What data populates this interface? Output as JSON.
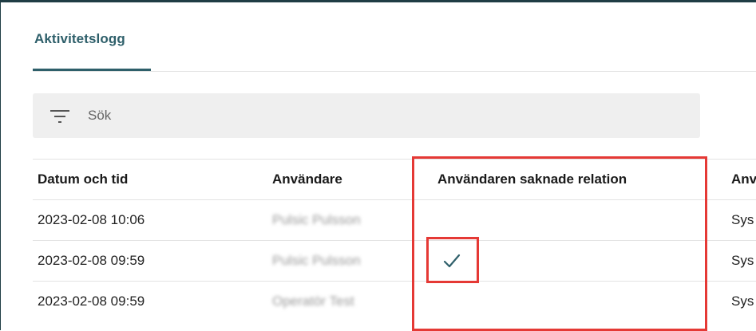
{
  "tabs": [
    {
      "label": "Aktivitetslogg",
      "active": true
    }
  ],
  "search": {
    "placeholder": "Sök",
    "icon": "filter-icon"
  },
  "table": {
    "columns": [
      "Datum och tid",
      "Användare",
      "Användaren saknade relation",
      "Anv"
    ],
    "rows": [
      {
        "datetime": "2023-02-08 10:06",
        "user": "Pulsic Pulsson",
        "missing_relation": false,
        "type": "Sys"
      },
      {
        "datetime": "2023-02-08 09:59",
        "user": "Pulsic Pulsson",
        "missing_relation": true,
        "type": "Sys"
      },
      {
        "datetime": "2023-02-08 09:59",
        "user": "Operatör Test",
        "missing_relation": false,
        "type": "Sys"
      }
    ]
  },
  "colors": {
    "accent": "#2e5f6a",
    "highlight": "#e53935",
    "frame": "#1f3d44"
  }
}
